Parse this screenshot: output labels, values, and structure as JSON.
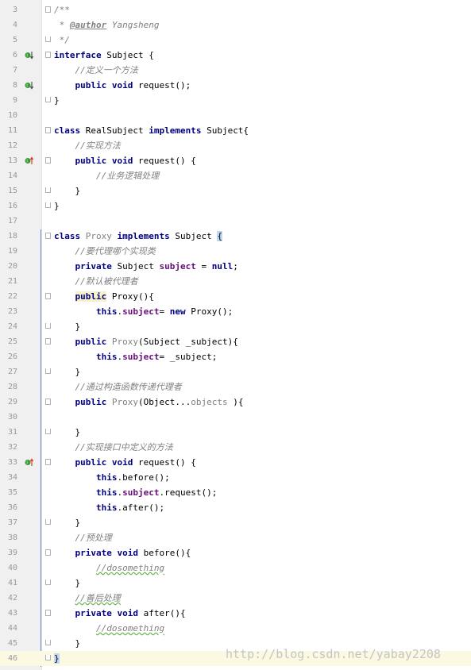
{
  "editor": {
    "language": "java",
    "current_line": 46,
    "watermark": "http://blog.csdn.net/yabay2208",
    "lines": [
      {
        "n": "3",
        "parts": [
          [
            "/**",
            "doc"
          ]
        ],
        "fold": "start"
      },
      {
        "n": "4",
        "parts": [
          [
            " * ",
            "doc"
          ],
          [
            "@author",
            "tag"
          ],
          [
            " Yangsheng",
            "doc"
          ]
        ]
      },
      {
        "n": "5",
        "parts": [
          [
            " */",
            "doc"
          ]
        ],
        "fold": "end"
      },
      {
        "n": "6",
        "parts": [
          [
            "interface",
            "kw"
          ],
          [
            " Subject {",
            ""
          ]
        ],
        "fold": "start",
        "icon": "implemented-down"
      },
      {
        "n": "7",
        "parts": [
          [
            "    ",
            ""
          ],
          [
            "//定义一个方法",
            "com"
          ]
        ]
      },
      {
        "n": "8",
        "parts": [
          [
            "    ",
            ""
          ],
          [
            "public void",
            "kw"
          ],
          [
            " request();",
            ""
          ]
        ],
        "icon": "implemented-down"
      },
      {
        "n": "9",
        "parts": [
          [
            "}",
            ""
          ]
        ],
        "fold": "end"
      },
      {
        "n": "10",
        "parts": []
      },
      {
        "n": "11",
        "parts": [
          [
            "class",
            "kw"
          ],
          [
            " RealSubject ",
            ""
          ],
          [
            "implements",
            "kw"
          ],
          [
            " Subject{",
            ""
          ]
        ],
        "fold": "start"
      },
      {
        "n": "12",
        "parts": [
          [
            "    ",
            ""
          ],
          [
            "//实现方法",
            "com"
          ]
        ]
      },
      {
        "n": "13",
        "parts": [
          [
            "    ",
            ""
          ],
          [
            "public void",
            "kw"
          ],
          [
            " request() {",
            ""
          ]
        ],
        "fold": "start",
        "icon": "implements-up"
      },
      {
        "n": "14",
        "parts": [
          [
            "        ",
            ""
          ],
          [
            "//业务逻辑处理",
            "com"
          ]
        ]
      },
      {
        "n": "15",
        "parts": [
          [
            "    }",
            ""
          ]
        ],
        "fold": "end"
      },
      {
        "n": "16",
        "parts": [
          [
            "}",
            ""
          ]
        ],
        "fold": "end"
      },
      {
        "n": "17",
        "parts": []
      },
      {
        "n": "18",
        "parts": [
          [
            "class",
            "kw"
          ],
          [
            " Proxy ",
            "unused"
          ],
          [
            "implements",
            "kw"
          ],
          [
            " Subject ",
            ""
          ],
          [
            "{",
            "brace-hl"
          ]
        ],
        "fold": "start"
      },
      {
        "n": "19",
        "parts": [
          [
            "    ",
            ""
          ],
          [
            "//要代理哪个实现类",
            "com"
          ]
        ]
      },
      {
        "n": "20",
        "parts": [
          [
            "    ",
            ""
          ],
          [
            "private",
            "kw"
          ],
          [
            " Subject ",
            ""
          ],
          [
            "subject",
            "fld"
          ],
          [
            " = ",
            ""
          ],
          [
            "null",
            "kw"
          ],
          [
            ";",
            ""
          ]
        ]
      },
      {
        "n": "21",
        "parts": [
          [
            "    ",
            ""
          ],
          [
            "//默认被代理者",
            "com"
          ]
        ]
      },
      {
        "n": "22",
        "parts": [
          [
            "    ",
            ""
          ],
          [
            "public",
            "kw-hl-kw"
          ],
          [
            " Proxy(){",
            ""
          ]
        ],
        "fold": "start"
      },
      {
        "n": "23",
        "parts": [
          [
            "        ",
            ""
          ],
          [
            "this",
            "kw"
          ],
          [
            ".",
            ""
          ],
          [
            "subject",
            "fld"
          ],
          [
            "= ",
            ""
          ],
          [
            "new",
            "kw"
          ],
          [
            " Proxy();",
            ""
          ]
        ]
      },
      {
        "n": "24",
        "parts": [
          [
            "    }",
            ""
          ]
        ],
        "fold": "end"
      },
      {
        "n": "25",
        "parts": [
          [
            "    ",
            ""
          ],
          [
            "public",
            "kw"
          ],
          [
            " ",
            ""
          ],
          [
            "Proxy",
            "unused"
          ],
          [
            "(Subject _subject){",
            ""
          ]
        ],
        "fold": "start"
      },
      {
        "n": "26",
        "parts": [
          [
            "        ",
            ""
          ],
          [
            "this",
            "kw"
          ],
          [
            ".",
            ""
          ],
          [
            "subject",
            "fld"
          ],
          [
            "= _subject;",
            ""
          ]
        ]
      },
      {
        "n": "27",
        "parts": [
          [
            "    }",
            ""
          ]
        ],
        "fold": "end"
      },
      {
        "n": "28",
        "parts": [
          [
            "    ",
            ""
          ],
          [
            "//通过构造函数传递代理者",
            "com"
          ]
        ]
      },
      {
        "n": "29",
        "parts": [
          [
            "    ",
            ""
          ],
          [
            "public",
            "kw"
          ],
          [
            " ",
            ""
          ],
          [
            "Proxy",
            "unused"
          ],
          [
            "(Object...",
            ""
          ],
          [
            "objects",
            "unused"
          ],
          [
            " ){",
            ""
          ]
        ],
        "fold": "start"
      },
      {
        "n": "30",
        "parts": []
      },
      {
        "n": "31",
        "parts": [
          [
            "    }",
            ""
          ]
        ],
        "fold": "end"
      },
      {
        "n": "32",
        "parts": [
          [
            "    ",
            ""
          ],
          [
            "//实现接口中定义的方法",
            "com"
          ]
        ]
      },
      {
        "n": "33",
        "parts": [
          [
            "    ",
            ""
          ],
          [
            "public void",
            "kw"
          ],
          [
            " request() {",
            ""
          ]
        ],
        "fold": "start",
        "icon": "implements-up"
      },
      {
        "n": "34",
        "parts": [
          [
            "        ",
            ""
          ],
          [
            "this",
            "kw"
          ],
          [
            ".before();",
            ""
          ]
        ]
      },
      {
        "n": "35",
        "parts": [
          [
            "        ",
            ""
          ],
          [
            "this",
            "kw"
          ],
          [
            ".",
            ""
          ],
          [
            "subject",
            "fld"
          ],
          [
            ".request();",
            ""
          ]
        ]
      },
      {
        "n": "36",
        "parts": [
          [
            "        ",
            ""
          ],
          [
            "this",
            "kw"
          ],
          [
            ".after();",
            ""
          ]
        ]
      },
      {
        "n": "37",
        "parts": [
          [
            "    }",
            ""
          ]
        ],
        "fold": "end"
      },
      {
        "n": "38",
        "parts": [
          [
            "    ",
            ""
          ],
          [
            "//预处理",
            "com"
          ]
        ]
      },
      {
        "n": "39",
        "parts": [
          [
            "    ",
            ""
          ],
          [
            "private void",
            "kw"
          ],
          [
            " before(){",
            ""
          ]
        ],
        "fold": "start"
      },
      {
        "n": "40",
        "parts": [
          [
            "        ",
            ""
          ],
          [
            "//dosomething",
            "com-typo"
          ]
        ]
      },
      {
        "n": "41",
        "parts": [
          [
            "    }",
            ""
          ]
        ],
        "fold": "end"
      },
      {
        "n": "42",
        "parts": [
          [
            "    ",
            ""
          ],
          [
            "//善后处理",
            "com-typo"
          ]
        ]
      },
      {
        "n": "43",
        "parts": [
          [
            "    ",
            ""
          ],
          [
            "private void",
            "kw"
          ],
          [
            " after(){",
            ""
          ]
        ],
        "fold": "start"
      },
      {
        "n": "44",
        "parts": [
          [
            "        ",
            ""
          ],
          [
            "//dosomething",
            "com-typo"
          ]
        ]
      },
      {
        "n": "45",
        "parts": [
          [
            "    }",
            ""
          ]
        ],
        "fold": "end"
      },
      {
        "n": "46",
        "parts": [
          [
            "}",
            "brace-hl"
          ]
        ],
        "fold": "end"
      }
    ]
  },
  "colors": {
    "keyword": "#000080",
    "comment": "#808080",
    "field": "#660e7a",
    "current_line_bg": "#fcf9e2",
    "brace_match_bg": "#c2d8f2",
    "gutter_bg": "#f0f0f0"
  }
}
